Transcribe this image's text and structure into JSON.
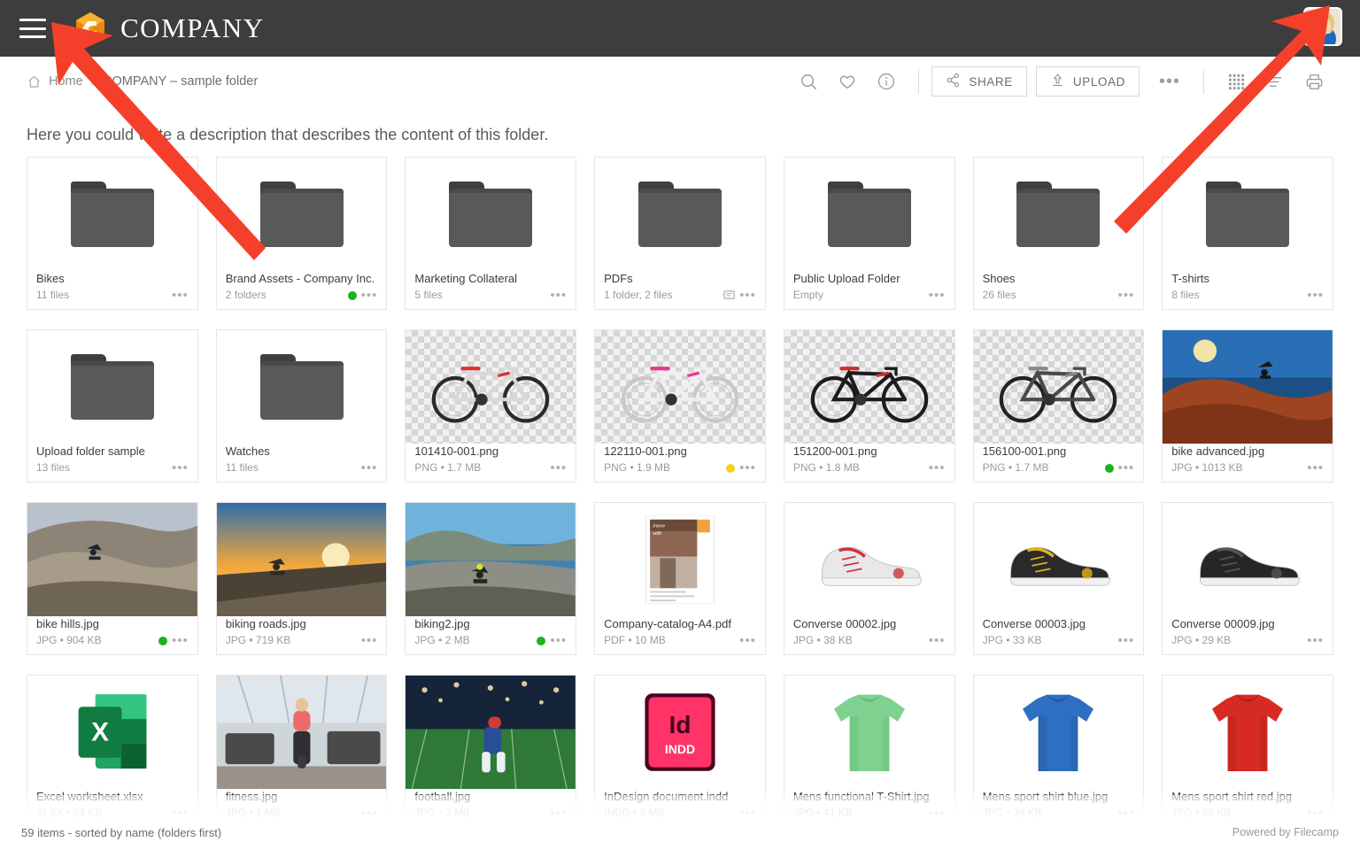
{
  "header": {
    "menu_icon": "hamburger-icon",
    "logo_icon": "company-c-logo",
    "brand": "COMPANY",
    "avatar_icon": "user-avatar"
  },
  "breadcrumb": {
    "home_icon": "home-icon",
    "home": "Home",
    "separator": "›",
    "current": "COMPANY – sample folder"
  },
  "toolbar": {
    "search_icon": "search-icon",
    "favorite_icon": "heart-icon",
    "info_icon": "info-icon",
    "share_label": "SHARE",
    "share_icon": "share-icon",
    "upload_label": "UPLOAD",
    "upload_icon": "upload-icon",
    "more_label": "•••",
    "grid_icon": "grid-view-icon",
    "list_icon": "list-view-icon",
    "print_icon": "print-icon"
  },
  "description": "Here you could write a description that describes the content of this folder.",
  "colors": {
    "brand_orange": "#F2A31B",
    "topbar": "#3d3d3d",
    "green_status": "#1DB21D",
    "yellow_status": "#F2D024",
    "arrow_red": "#F4402A"
  },
  "items": [
    {
      "name": "Bikes",
      "sub": "11 files",
      "kind": "folder",
      "status": ""
    },
    {
      "name": "Brand Assets - Company Inc.",
      "sub": "2 folders",
      "kind": "folder",
      "status": "green"
    },
    {
      "name": "Marketing Collateral",
      "sub": "5 files",
      "kind": "folder",
      "status": ""
    },
    {
      "name": "PDFs",
      "sub": "1 folder, 2 files",
      "kind": "folder",
      "status": "",
      "comment": true
    },
    {
      "name": "Public Upload Folder",
      "sub": "Empty",
      "kind": "folder",
      "status": ""
    },
    {
      "name": "Shoes",
      "sub": "26 files",
      "kind": "folder",
      "status": ""
    },
    {
      "name": "T-shirts",
      "sub": "8 files",
      "kind": "folder",
      "status": ""
    },
    {
      "name": "Upload folder sample",
      "sub": "13 files",
      "kind": "folder",
      "status": ""
    },
    {
      "name": "Watches",
      "sub": "11 files",
      "kind": "folder",
      "status": ""
    },
    {
      "name": "101410-001.png",
      "sub": "PNG • 1.7 MB",
      "kind": "png-bike-white",
      "status": ""
    },
    {
      "name": "122110-001.png",
      "sub": "PNG • 1.9 MB",
      "kind": "png-bike-pink",
      "status": "yellow"
    },
    {
      "name": "151200-001.png",
      "sub": "PNG • 1.8 MB",
      "kind": "png-bike-black",
      "status": ""
    },
    {
      "name": "156100-001.png",
      "sub": "PNG • 1.7 MB",
      "kind": "png-bike-gray",
      "status": "green"
    },
    {
      "name": "bike advanced.jpg",
      "sub": "JPG • 1013 KB",
      "kind": "photo-desert-jump",
      "status": ""
    },
    {
      "name": "bike hills.jpg",
      "sub": "JPG • 904 KB",
      "kind": "photo-hills",
      "status": "green"
    },
    {
      "name": "biking roads.jpg",
      "sub": "JPG • 719 KB",
      "kind": "photo-road-sunset",
      "status": ""
    },
    {
      "name": "biking2.jpg",
      "sub": "JPG • 2 MB",
      "kind": "photo-coast",
      "status": "green"
    },
    {
      "name": "Company-catalog-A4.pdf",
      "sub": "PDF • 10 MB",
      "kind": "pdf-catalog",
      "status": ""
    },
    {
      "name": "Converse 00002.jpg",
      "sub": "JPG • 38 KB",
      "kind": "shoe-red",
      "status": ""
    },
    {
      "name": "Converse 00003.jpg",
      "sub": "JPG • 33 KB",
      "kind": "shoe-yellow",
      "status": ""
    },
    {
      "name": "Converse 00009.jpg",
      "sub": "JPG • 29 KB",
      "kind": "shoe-black",
      "status": ""
    },
    {
      "name": "Excel worksheet.xlsx",
      "sub": "XLSX • 24 KB",
      "kind": "excel",
      "status": ""
    },
    {
      "name": "fitness.jpg",
      "sub": "JPG • 1 MB",
      "kind": "photo-gym",
      "status": ""
    },
    {
      "name": "football.jpg",
      "sub": "JPG • 2 MB",
      "kind": "photo-football",
      "status": ""
    },
    {
      "name": "InDesign document.indd",
      "sub": "INDD • 3 MB",
      "kind": "indesign",
      "status": ""
    },
    {
      "name": "Mens functional T-Shirt.jpg",
      "sub": "JPG • 41 KB",
      "kind": "shirt-green",
      "status": ""
    },
    {
      "name": "Mens sport shirt blue.jpg",
      "sub": "JPG • 38 KB",
      "kind": "shirt-blue",
      "status": ""
    },
    {
      "name": "Mens sport shirt red.jpg",
      "sub": "JPG • 36 KB",
      "kind": "shirt-red",
      "status": ""
    }
  ],
  "footer": {
    "status": "59 items - sorted by name (folders first)",
    "powered": "Powered by Filecamp"
  }
}
